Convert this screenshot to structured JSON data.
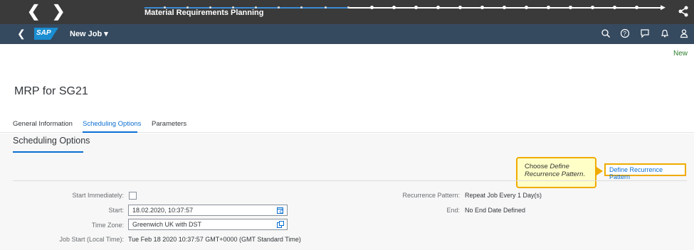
{
  "tutorial": {
    "title": "Material Requirements Planning"
  },
  "shell": {
    "title": "New Job ▾",
    "logo": "SAP"
  },
  "page": {
    "new_link": "New",
    "object_title": "MRP for SG21",
    "tabs": [
      "General Information",
      "Scheduling Options",
      "Parameters"
    ],
    "section_title": "Scheduling Options"
  },
  "form": {
    "start_immediately_label": "Start Immediately:",
    "start_label": "Start:",
    "start_value": "18.02.2020, 10:37:57",
    "timezone_label": "Time Zone:",
    "timezone_value": "Greenwich UK with DST",
    "job_start_label": "Job Start (Local Time):",
    "job_start_value": "Tue Feb 18 2020 10:37:57 GMT+0000 (GMT Standard Time)",
    "recurrence_label": "Recurrence Pattern:",
    "recurrence_value": "Repeat Job Every 1 Day(s)",
    "end_label": "End:",
    "end_value": "No End Date Defined"
  },
  "actions": {
    "define_recurrence": "Define Recurrence Pattern"
  },
  "callout": {
    "line1_prefix": "Choose ",
    "line1_em": "Define",
    "line2_em": "Recurrence Pattern",
    "line2_suffix": "."
  },
  "colors": {
    "accent": "#0a6ed1",
    "shell": "#354a5f",
    "highlight": "#f0ab00",
    "callout_bg": "#ffffc8"
  }
}
